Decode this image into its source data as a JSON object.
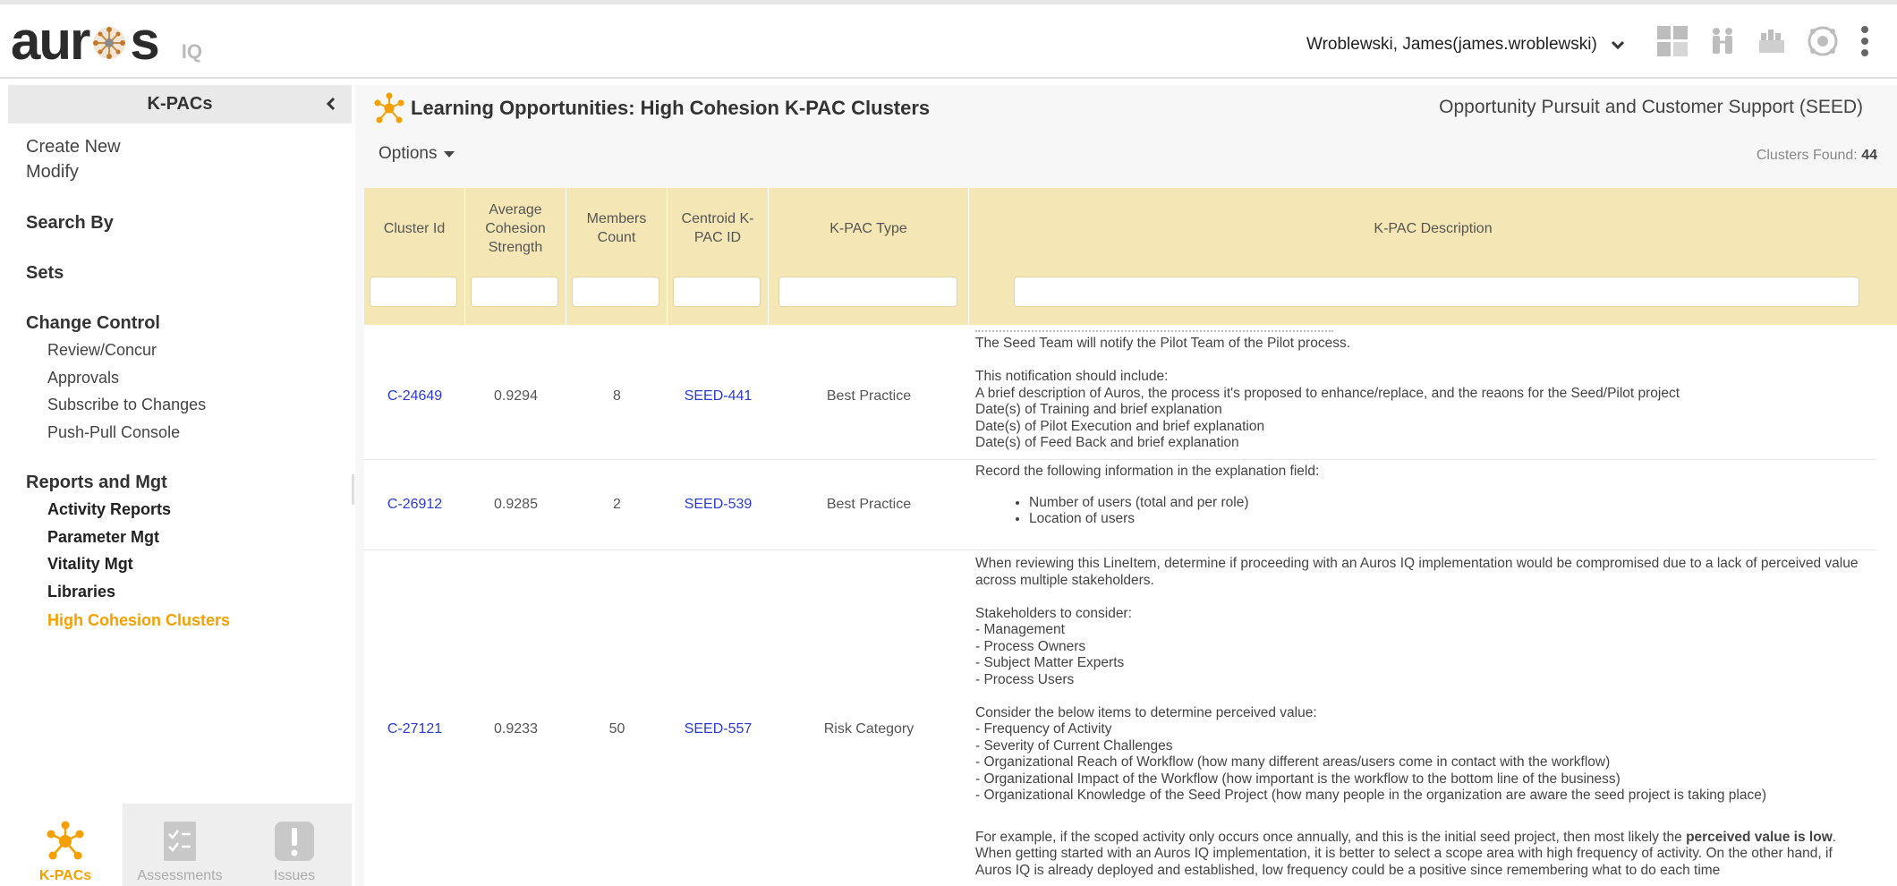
{
  "header": {
    "logo_text_left": "aur",
    "logo_text_right": "s",
    "logo_iq": "IQ",
    "user_name": "Wroblewski, James(james.wroblewski)",
    "icons": [
      "dashboard-icon",
      "people-icon",
      "team-icon",
      "network-icon",
      "kebab-menu-icon"
    ]
  },
  "sidebar": {
    "title": "K-PACs",
    "links": [
      "Create New",
      "Modify"
    ],
    "search_by": "Search By",
    "sets": "Sets",
    "change_control": {
      "label": "Change Control",
      "items": [
        "Review/Concur",
        "Approvals",
        "Subscribe to Changes",
        "Push-Pull Console"
      ]
    },
    "reports": {
      "label": "Reports and Mgt",
      "items": [
        "Activity Reports",
        "Parameter Mgt",
        "Vitality Mgt",
        "Libraries",
        "High Cohesion Clusters"
      ]
    },
    "tabs": [
      {
        "label": "K-PACs",
        "icon": "kpac-icon",
        "active": true
      },
      {
        "label": "Assessments",
        "icon": "assessments-icon",
        "active": false
      },
      {
        "label": "Issues",
        "icon": "issues-icon",
        "active": false
      }
    ]
  },
  "main": {
    "title": "Learning Opportunities: High Cohesion K-PAC Clusters",
    "context": "Opportunity Pursuit and Customer Support (SEED)",
    "options_label": "Options",
    "clusters_found_label": "Clusters Found:",
    "clusters_found_count": "44",
    "columns": [
      "Cluster Id",
      "Average Cohesion Strength",
      "Members Count",
      "Centroid K-PAC ID",
      "K-PAC Type",
      "K-PAC Description"
    ],
    "rows": [
      {
        "cluster_id": "C-24649",
        "cohesion": "0.9294",
        "members": "8",
        "centroid": "SEED-441",
        "type": "Best Practice",
        "desc": "The Seed Team will notify the Pilot Team of the Pilot process.\n\nThis notification should include:\nA brief description of Auros, the process it's proposed to enhance/replace, and the reaons for the Seed/Pilot project\nDate(s) of Training and brief explanation\nDate(s) of Pilot Execution and brief explanation\nDate(s) of Feed Back and brief explanation"
      },
      {
        "cluster_id": "C-26912",
        "cohesion": "0.9285",
        "members": "2",
        "centroid": "SEED-539",
        "type": "Best Practice",
        "desc": "Record the following information in the explanation field:",
        "bullets": [
          "Number of users (total and per role)",
          "Location of users"
        ]
      },
      {
        "cluster_id": "C-27121",
        "cohesion": "0.9233",
        "members": "50",
        "centroid": "SEED-557",
        "type": "Risk Category",
        "desc": "When reviewing this LineItem, determine if proceeding with an Auros IQ implementation would be compromised due to a lack of perceived value across multiple stakeholders.\n\nStakeholders to consider:\n- Management\n- Process Owners\n- Subject Matter Experts\n- Process Users\n\nConsider the below items to determine perceived value:\n- Frequency of Activity\n- Severity of Current Challenges\n- Organizational Reach of Workflow (how many different areas/users come in contact with the workflow)\n- Organizational Impact of the Workflow (how important is the workflow to the bottom line of the business)\n- Organizational Knowledge of the Seed Project (how many people in the organization are aware the seed project is taking place)",
        "desc_tail_pre": "For example, if the scoped activity only occurs once annually, and this is the initial seed project, then most likely the ",
        "desc_tail_bold": "perceived value is low",
        "desc_tail_post": ". When getting started with an Auros IQ implementation, it is better to select a scope area with high frequency of activity. On the other hand, if Auros IQ is already deployed and established, low frequency could be a positive since remembering what to do each time"
      }
    ]
  },
  "colors": {
    "accent": "#f5a000",
    "header_bg": "#f5e6b5",
    "link": "#2b3bd6"
  }
}
